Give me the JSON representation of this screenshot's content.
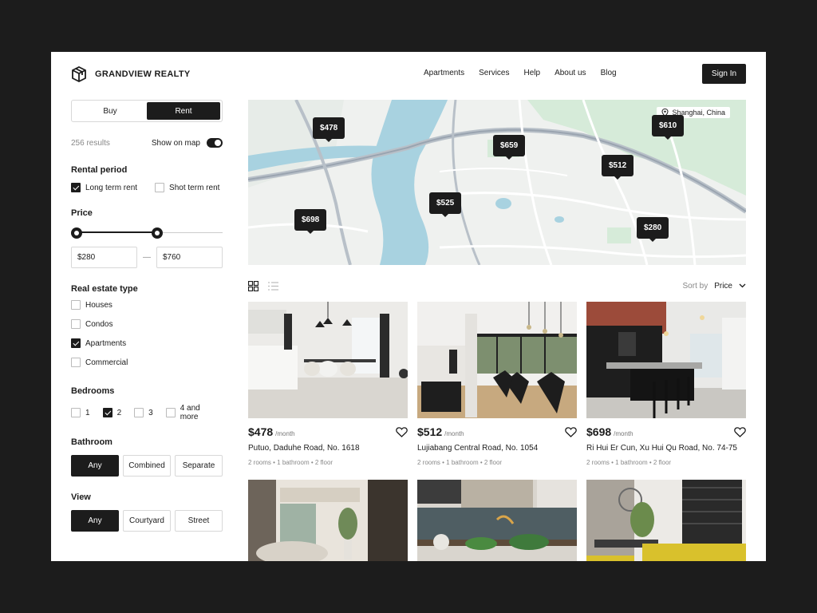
{
  "brand": {
    "name": "GRANDVIEW REALTY"
  },
  "nav": [
    "Apartments",
    "Services",
    "Help",
    "About us",
    "Blog"
  ],
  "signin_label": "Sign In",
  "filters": {
    "mode_options": [
      "Buy",
      "Rent"
    ],
    "mode_selected": "Rent",
    "results_count": "256 results",
    "show_on_map_label": "Show on map",
    "show_on_map": true,
    "rental_period": {
      "title": "Rental period",
      "options": [
        {
          "label": "Long term rent",
          "checked": true
        },
        {
          "label": "Shot term rent",
          "checked": false
        }
      ]
    },
    "price": {
      "title": "Price",
      "min": "$280",
      "max": "$760",
      "range_separator": "—"
    },
    "real_estate_type": {
      "title": "Real estate type",
      "options": [
        {
          "label": "Houses",
          "checked": false
        },
        {
          "label": "Condos",
          "checked": false
        },
        {
          "label": "Apartments",
          "checked": true
        },
        {
          "label": "Commercial",
          "checked": false
        }
      ]
    },
    "bedrooms": {
      "title": "Bedrooms",
      "options": [
        {
          "label": "1",
          "checked": false
        },
        {
          "label": "2",
          "checked": true
        },
        {
          "label": "3",
          "checked": false
        },
        {
          "label": "4 and more",
          "checked": false
        }
      ]
    },
    "bathroom": {
      "title": "Bathroom",
      "options": [
        "Any",
        "Combined",
        "Separate"
      ],
      "selected": "Any"
    },
    "view": {
      "title": "View",
      "options": [
        "Any",
        "Courtyard",
        "Street"
      ],
      "selected": "Any"
    }
  },
  "map": {
    "location_label": "Shanghai, China",
    "pins": [
      "$478",
      "$659",
      "$610",
      "$512",
      "$525",
      "$698",
      "$280"
    ]
  },
  "list": {
    "sort_label": "Sort by",
    "sort_value": "Price"
  },
  "properties": [
    {
      "price": "$478",
      "per": "/month",
      "address": "Putuo, Daduhe Road, No. 1618",
      "meta": "2 rooms  •  1 bathroom  •  2 floor"
    },
    {
      "price": "$512",
      "per": "/month",
      "address": "Lujiabang Central Road, No. 1054",
      "meta": "2 rooms  •  1 bathroom  •  2 floor"
    },
    {
      "price": "$698",
      "per": "/month",
      "address": "Ri Hui Er Cun, Xu Hui Qu Road, No. 74-75",
      "meta": "2 rooms  •  1 bathroom  •  2 floor"
    },
    {
      "price": "",
      "per": "",
      "address": "",
      "meta": ""
    },
    {
      "price": "",
      "per": "",
      "address": "",
      "meta": ""
    },
    {
      "price": "",
      "per": "",
      "address": "",
      "meta": ""
    }
  ],
  "icons": {
    "logo": "cube-logo-icon",
    "location": "map-pin-icon",
    "grid_view": "grid-view-icon",
    "list_view": "list-view-icon",
    "sort": "chevron-down-icon",
    "favorite": "heart-icon"
  },
  "colors": {
    "accent": "#1c1c1c",
    "map_water": "#a8d2e0",
    "map_park": "#cfe6d2"
  }
}
